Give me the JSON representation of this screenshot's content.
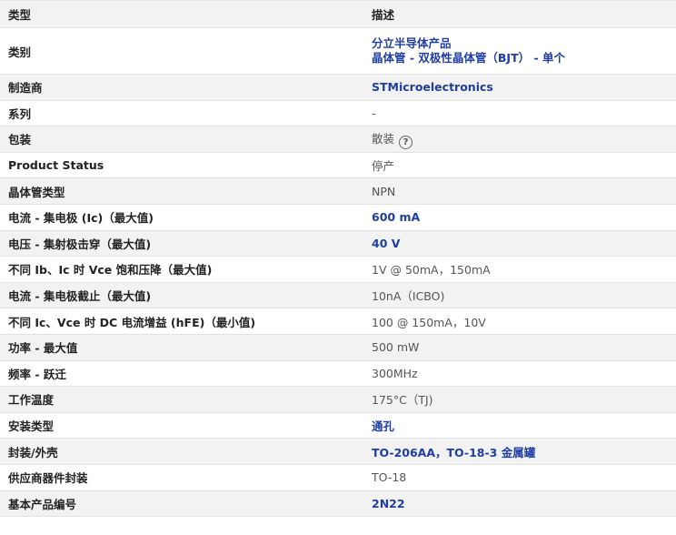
{
  "header": {
    "type": "类型",
    "desc": "描述"
  },
  "rows": [
    {
      "label": "类别",
      "value_lines": [
        "分立半导体产品",
        "晶体管 - 双极性晶体管（BJT） - 单个"
      ],
      "link": true
    },
    {
      "label": "制造商",
      "value": "STMicroelectronics",
      "link": true
    },
    {
      "label": "系列",
      "value": "-",
      "link": false
    },
    {
      "label": "包装",
      "value": "散装",
      "link": false,
      "help_icon": "help-circle-icon",
      "help_glyph": "?"
    },
    {
      "label": "Product Status",
      "value": "停产",
      "link": false
    },
    {
      "label": "晶体管类型",
      "value": "NPN",
      "link": false
    },
    {
      "label": "电流 - 集电极 (Ic)（最大值)",
      "value": "600 mA",
      "link": true
    },
    {
      "label": "电压 - 集射极击穿（最大值)",
      "value": "40 V",
      "link": true
    },
    {
      "label": "不同 Ib、Ic 时 Vce 饱和压降（最大值)",
      "value": "1V @ 50mA，150mA",
      "link": false
    },
    {
      "label": "电流 - 集电极截止（最大值)",
      "value": "10nA（ICBO)",
      "link": false
    },
    {
      "label": "不同 Ic、Vce 时 DC 电流增益 (hFE)（最小值)",
      "value": "100 @ 150mA，10V",
      "link": false
    },
    {
      "label": "功率 - 最大值",
      "value": "500 mW",
      "link": false
    },
    {
      "label": "频率 - 跃迁",
      "value": "300MHz",
      "link": false
    },
    {
      "label": "工作温度",
      "value": "175°C（TJ)",
      "link": false
    },
    {
      "label": "安装类型",
      "value": "通孔",
      "link": true
    },
    {
      "label": "封装/外壳",
      "value": "TO-206AA，TO-18-3 金属罐",
      "link": true
    },
    {
      "label": "供应商器件封装",
      "value": "TO-18",
      "link": false
    },
    {
      "label": "基本产品编号",
      "value": "2N22",
      "link": true
    }
  ]
}
